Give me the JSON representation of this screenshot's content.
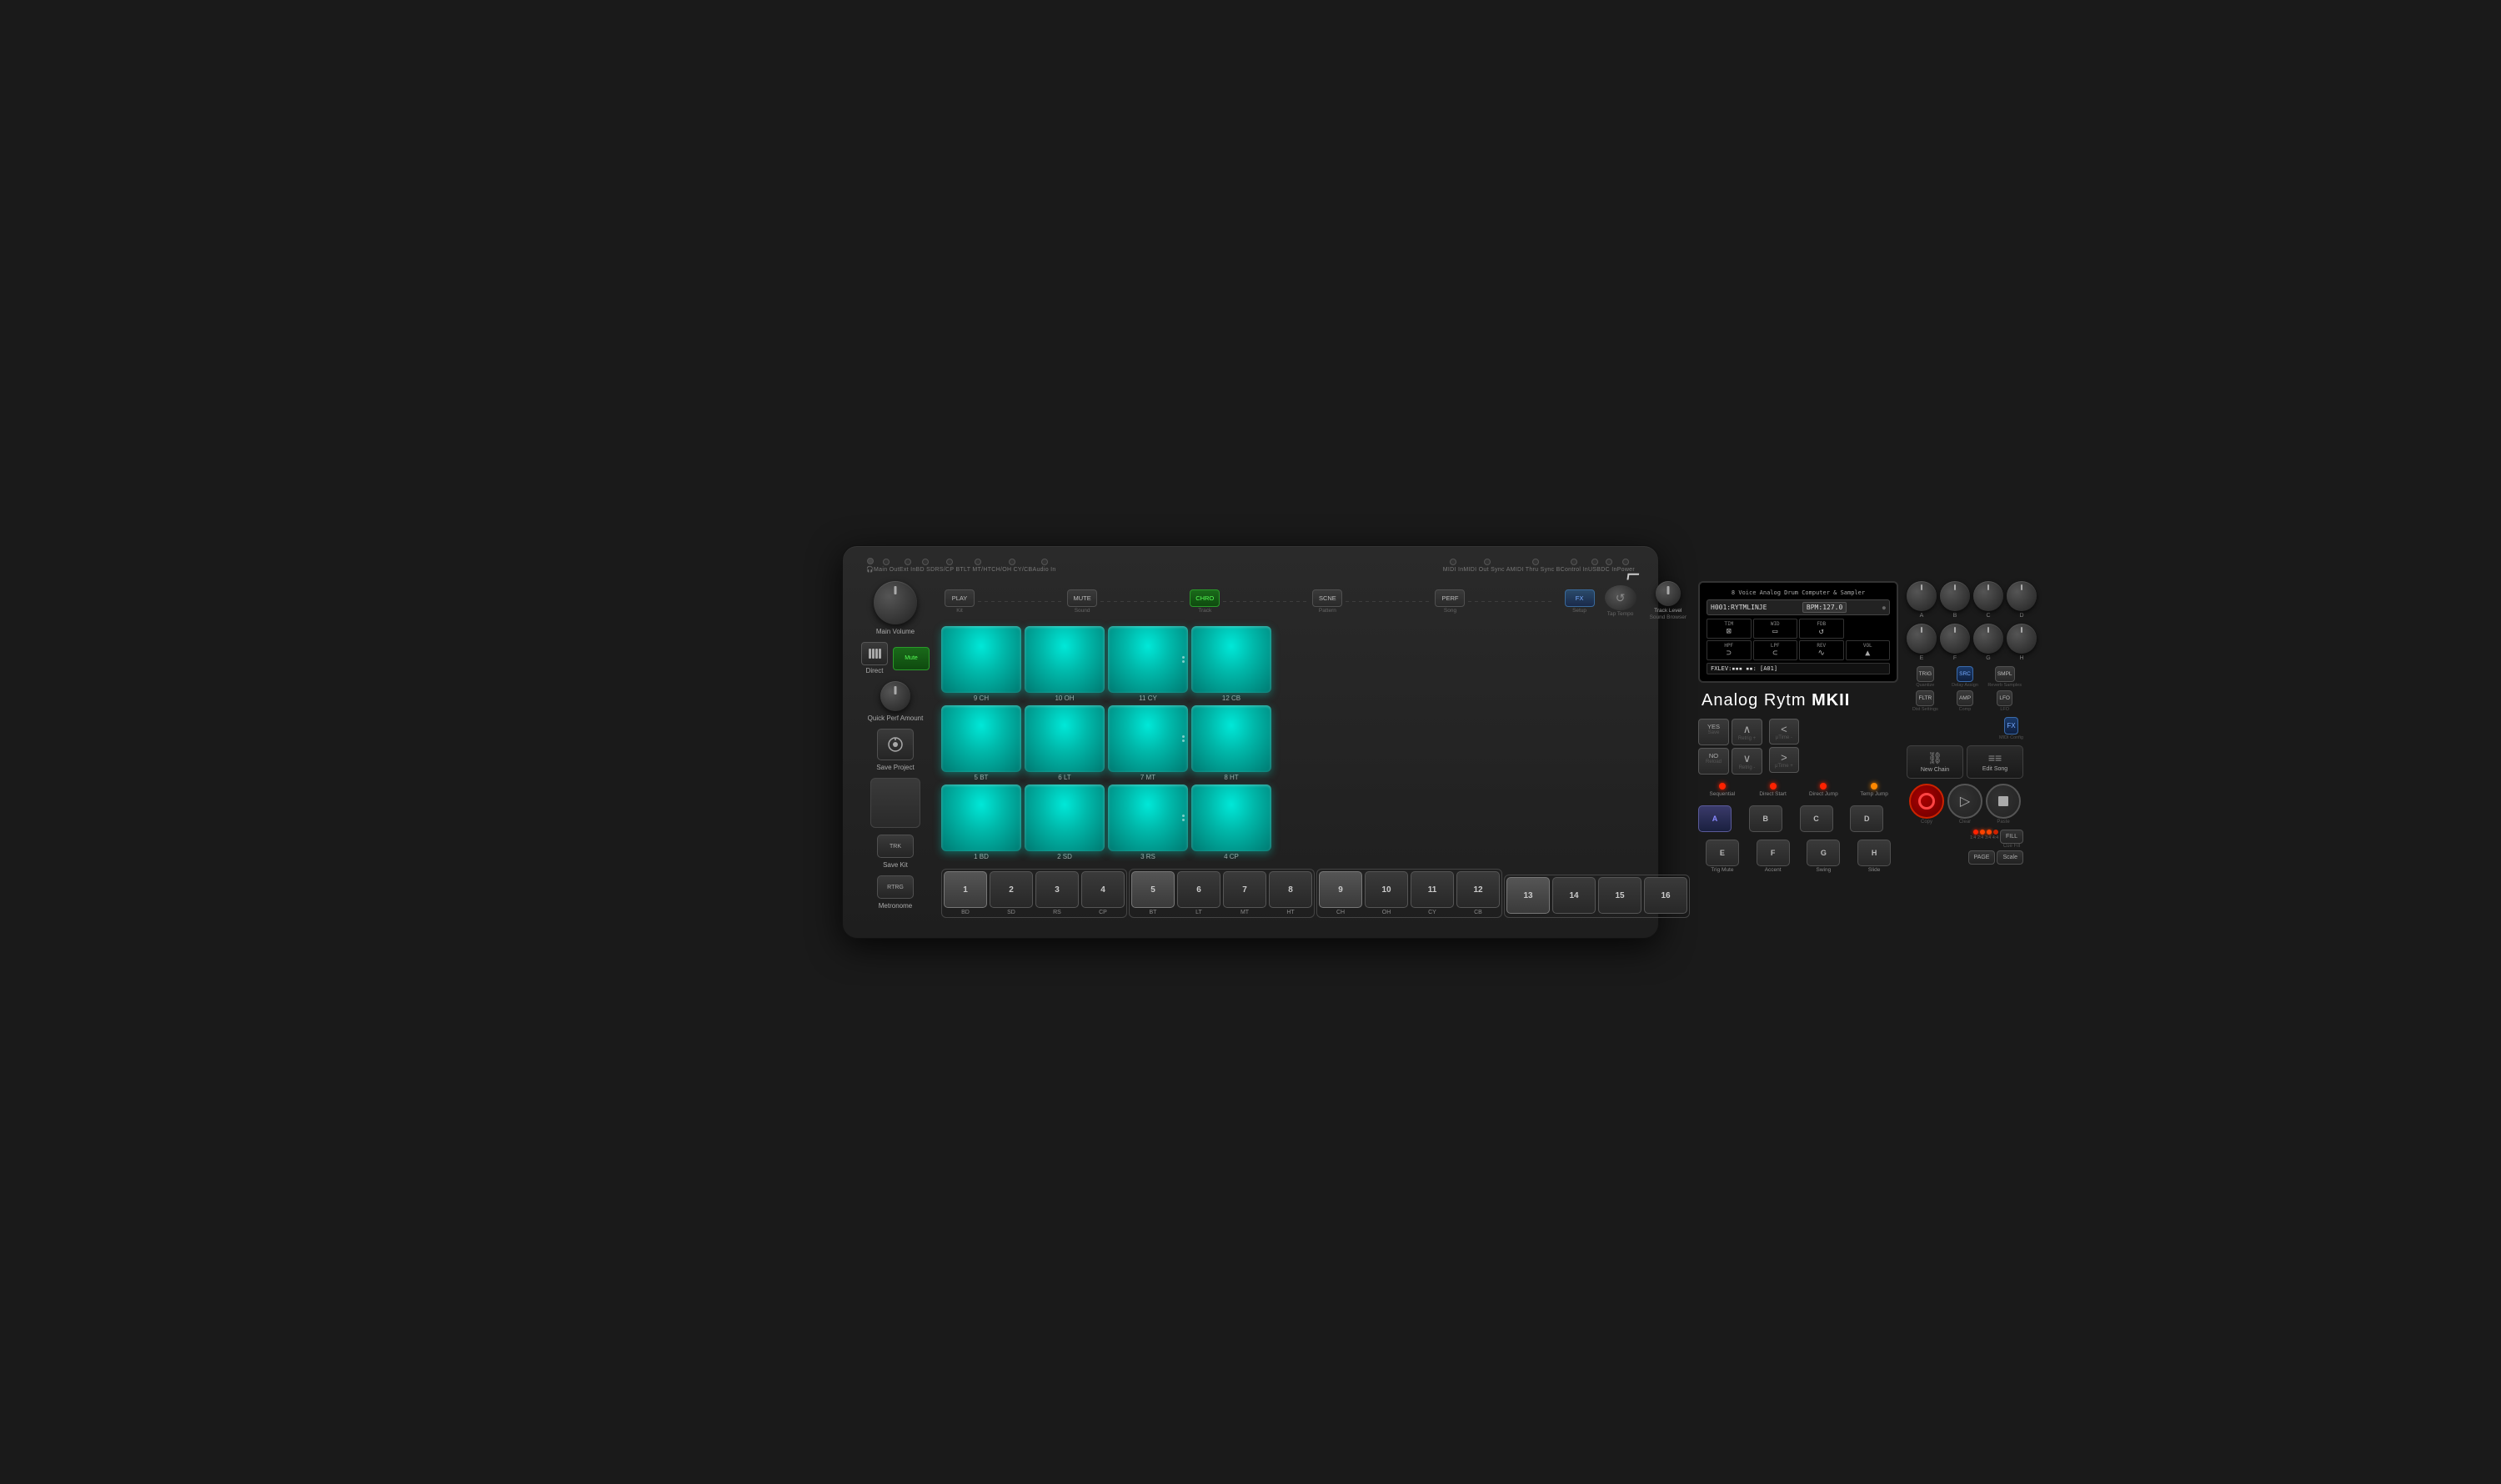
{
  "device": {
    "name": "Analog Rytm MKII",
    "subtitle": "8 Voice Analog Drum Computer & Sampler"
  },
  "logo": "⌐",
  "io_labels": [
    {
      "label": "🎧",
      "sub": ""
    },
    {
      "label": "Main Out",
      "sub": ""
    },
    {
      "label": "Ext In",
      "sub": ""
    },
    {
      "label": "BD SD",
      "sub": ""
    },
    {
      "label": "RS/CP BT",
      "sub": ""
    },
    {
      "label": "LT MT/HT",
      "sub": ""
    },
    {
      "label": "CH/OH CY/CB",
      "sub": ""
    },
    {
      "label": "Audio In",
      "sub": ""
    },
    {
      "label": "MIDI In",
      "sub": ""
    },
    {
      "label": "MIDI Out Sync A",
      "sub": ""
    },
    {
      "label": "MIDI Thru Sync B",
      "sub": ""
    },
    {
      "label": "Control In",
      "sub": ""
    },
    {
      "label": "USB",
      "sub": ""
    },
    {
      "label": "DC In",
      "sub": ""
    },
    {
      "label": "Power",
      "sub": ""
    }
  ],
  "left_controls": {
    "main_volume_label": "Main Volume",
    "direct_label": "Direct",
    "mute_label": "Mute",
    "quick_perf_label": "Quick Perf Amount",
    "track_level_label": "Track Level",
    "sound_browser_label": "Sound Browser",
    "save_project_label": "Save Project",
    "tap_tempo_label": "Tap Tempo",
    "save_kit_label": "Save Kit",
    "metronome_label": "Metronome"
  },
  "transport_buttons": [
    {
      "label": "PLAY",
      "id": "play",
      "sub": "Kit"
    },
    {
      "label": "MUTE",
      "id": "mute-btn",
      "sub": "Sound"
    },
    {
      "label": "CHRO",
      "id": "chro",
      "sub": "Track",
      "active": true
    },
    {
      "label": "SCNE",
      "id": "scne",
      "sub": "Pattern"
    },
    {
      "label": "PERF",
      "id": "perf",
      "sub": "Song"
    },
    {
      "label": "FX",
      "id": "fx",
      "sub": "Setup"
    },
    {
      "label": "↺",
      "id": "tap",
      "sub": "Tap Tempo"
    }
  ],
  "pads": [
    {
      "row": 3,
      "pads": [
        {
          "num": "9",
          "name": "CH",
          "has_mark": false
        },
        {
          "num": "10",
          "name": "OH",
          "has_mark": false
        },
        {
          "num": "11",
          "name": "CY",
          "has_mark": true
        },
        {
          "num": "12",
          "name": "CB",
          "has_mark": false
        }
      ]
    },
    {
      "row": 2,
      "pads": [
        {
          "num": "5",
          "name": "BT",
          "has_mark": false
        },
        {
          "num": "6",
          "name": "LT",
          "has_mark": false
        },
        {
          "num": "7",
          "name": "MT",
          "has_mark": true
        },
        {
          "num": "8",
          "name": "HT",
          "has_mark": false
        }
      ]
    },
    {
      "row": 1,
      "pads": [
        {
          "num": "1",
          "name": "BD",
          "has_mark": false
        },
        {
          "num": "2",
          "name": "SD",
          "has_mark": false
        },
        {
          "num": "3",
          "name": "RS",
          "has_mark": true
        },
        {
          "num": "4",
          "name": "CP",
          "has_mark": false
        }
      ]
    }
  ],
  "step_buttons": [
    {
      "num": "1",
      "label": "BD",
      "active": true
    },
    {
      "num": "2",
      "label": "SD",
      "active": false
    },
    {
      "num": "3",
      "label": "RS",
      "active": false
    },
    {
      "num": "4",
      "label": "CP",
      "active": false
    },
    {
      "num": "5",
      "label": "BT",
      "active": true
    },
    {
      "num": "6",
      "label": "LT",
      "active": false
    },
    {
      "num": "7",
      "label": "MT",
      "active": false
    },
    {
      "num": "8",
      "label": "HT",
      "active": false
    },
    {
      "num": "9",
      "label": "CH",
      "active": true
    },
    {
      "num": "10",
      "label": "OH",
      "active": false
    },
    {
      "num": "11",
      "label": "CY",
      "active": false
    },
    {
      "num": "12",
      "label": "CB",
      "active": false
    },
    {
      "num": "13",
      "label": "",
      "active": true
    },
    {
      "num": "14",
      "label": "",
      "active": false
    },
    {
      "num": "15",
      "label": "",
      "active": false
    },
    {
      "num": "16",
      "label": "",
      "active": false
    }
  ],
  "display": {
    "pattern_name": "H001:RYTMLINJE",
    "bpm": "BPM:127.0",
    "params": [
      {
        "name": "TIM",
        "symbol": "⊠"
      },
      {
        "name": "WID",
        "symbol": "▭"
      },
      {
        "name": "FDB",
        "symbol": "↺"
      },
      {
        "name": "HPF",
        "symbol": "⊃"
      },
      {
        "name": "LPF",
        "symbol": "⊂"
      },
      {
        "name": "REV",
        "symbol": "∿"
      },
      {
        "name": "VOL",
        "symbol": "▲"
      }
    ],
    "fx_line": "FXLEV:▪▪▪ ▪▪: [A01]"
  },
  "nav_controls": {
    "yes_label": "YES",
    "save_label": "Save",
    "no_label": "NO",
    "reload_label": "Reload",
    "up_label": "Retrig +",
    "left_label": "μTime -",
    "down_label": "Retrig -",
    "right_label": "μTime +",
    "sequential_label": "Sequential",
    "direct_start_label": "Direct Start",
    "direct_jump_label": "Direct Jump",
    "temp_jump_label": "Temp Jump"
  },
  "abcd_rows": {
    "row1": [
      "A",
      "B",
      "C",
      "D"
    ],
    "row2_labels": [
      "Trig Mute",
      "Accent",
      "Swing",
      "Slide"
    ],
    "row2_keys": [
      "E",
      "F",
      "G",
      "H"
    ]
  },
  "right_params": {
    "trig": "TRIG",
    "trig_sub": "Quantize",
    "src": "SRC",
    "src_sub": "Delay Assign",
    "smpl": "SMPL",
    "smpl_sub": "Reverb Samples",
    "fltr": "FLTR",
    "fltr_sub": "Dist Settings",
    "amp": "AMP",
    "amp_sub": "Comp",
    "lfo": "LFO",
    "lfo_sub": "LFO",
    "fx_label": "FX",
    "midi_config": "MIDI Config"
  },
  "chain_song": {
    "new_chain": "New Chain",
    "edit_song": "Edit Song"
  },
  "playback": {
    "copy_label": "Copy",
    "clear_label": "Clear",
    "paste_label": "Paste",
    "fill_label": "FILL",
    "cue_fill_label": "Cue Fill",
    "scale_label": "Scale",
    "page_label": "PAGE"
  },
  "knob_labels": {
    "a": "A",
    "b": "B",
    "c": "C",
    "d": "D",
    "e": "E",
    "f": "F",
    "g": "G",
    "h": "H"
  },
  "page_indicators": [
    "1:4",
    "2:4",
    "3:4",
    "4:4"
  ]
}
